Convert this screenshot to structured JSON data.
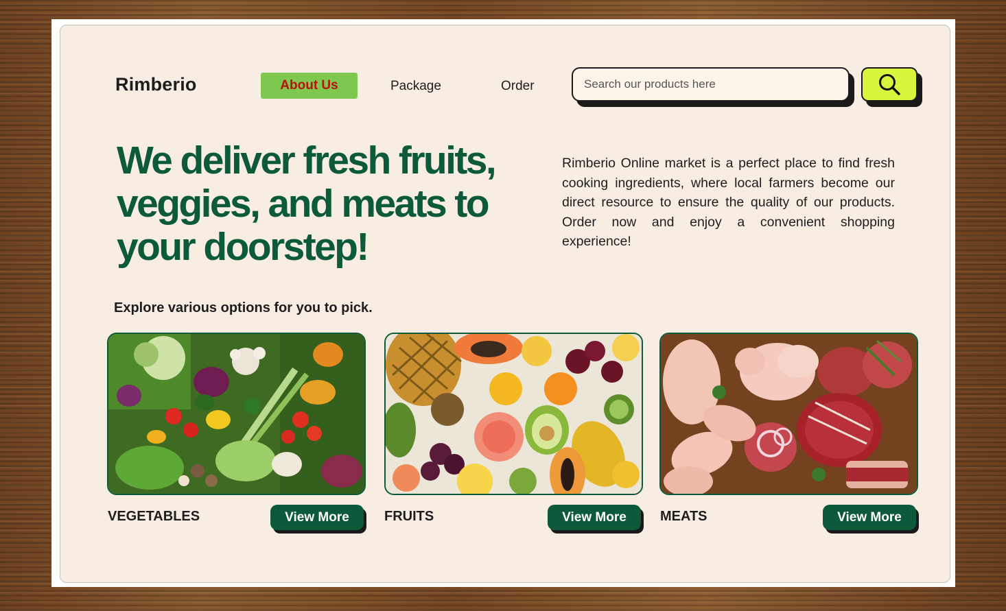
{
  "brand": {
    "name": "Rimberio"
  },
  "nav": {
    "items": [
      {
        "label": "About Us",
        "active": true
      },
      {
        "label": "Package",
        "active": false
      },
      {
        "label": "Order",
        "active": false
      }
    ]
  },
  "search": {
    "placeholder": "Search our products here",
    "value": "",
    "button_icon": "search-icon"
  },
  "hero": {
    "title": "We deliver fresh fruits, veggies, and meats to your doorstep!",
    "description": "Rimberio Online market is a perfect place to find fresh cooking ingredients, where local farmers become our direct resource to ensure the quality of our products. Order now and enjoy a convenient shopping experience!"
  },
  "explore": {
    "heading": "Explore various options for you to pick."
  },
  "categories": [
    {
      "label": "VEGETABLES",
      "button": "View More",
      "image": "vegetables-photo"
    },
    {
      "label": "FRUITS",
      "button": "View More",
      "image": "fruits-photo"
    },
    {
      "label": "MEATS",
      "button": "View More",
      "image": "meats-photo"
    }
  ],
  "colors": {
    "accent_green": "#0c5a3a",
    "nav_active_bg": "#7ec850",
    "nav_active_text": "#b8100a",
    "search_button_bg": "#d9f53e",
    "card_bg": "#f8ede2"
  }
}
